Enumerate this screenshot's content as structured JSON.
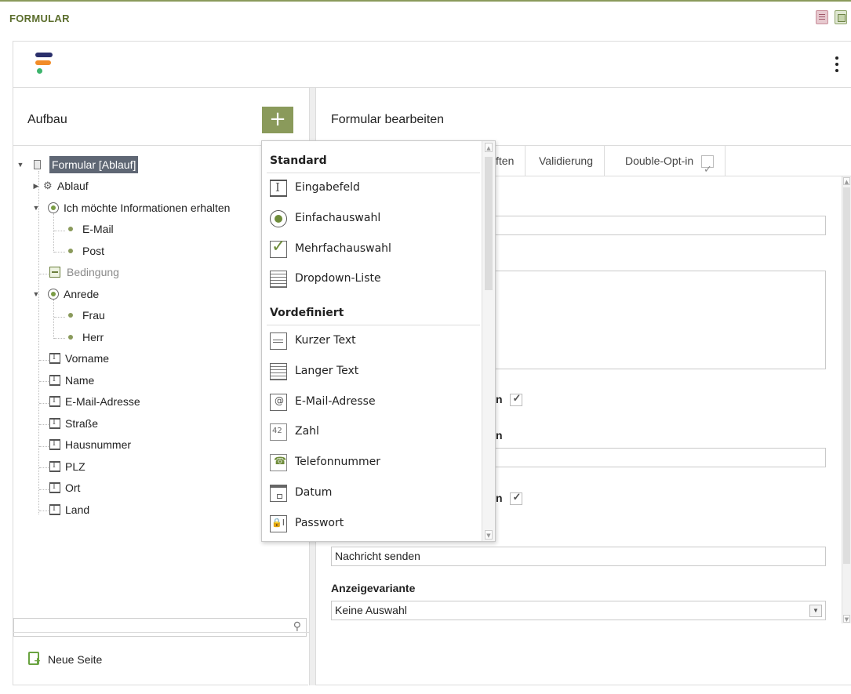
{
  "window": {
    "title": "FORMULAR"
  },
  "left_panel": {
    "title": "Aufbau",
    "add_label": "+",
    "tree": [
      {
        "label": "Formular [Ablauf]",
        "icon": "form-icon",
        "selected": true
      },
      {
        "label": "Ablauf",
        "icon": "gear-icon"
      },
      {
        "label": "Ich möchte Informationen erhalten",
        "icon": "radio-icon"
      },
      {
        "label": "E-Mail",
        "icon": "option-dot-icon"
      },
      {
        "label": "Post",
        "icon": "option-dot-icon"
      },
      {
        "label": "Bedingung",
        "icon": "condition-icon"
      },
      {
        "label": "Anrede",
        "icon": "radio-icon"
      },
      {
        "label": "Frau",
        "icon": "option-dot-icon"
      },
      {
        "label": "Herr",
        "icon": "option-dot-icon"
      },
      {
        "label": "Vorname",
        "icon": "text-field-icon"
      },
      {
        "label": "Name",
        "icon": "text-field-icon"
      },
      {
        "label": "E-Mail-Adresse",
        "icon": "text-field-icon"
      },
      {
        "label": "Straße",
        "icon": "text-field-icon"
      },
      {
        "label": "Hausnummer",
        "icon": "text-field-icon"
      },
      {
        "label": "PLZ",
        "icon": "text-field-icon"
      },
      {
        "label": "Ort",
        "icon": "text-field-icon"
      },
      {
        "label": "Land",
        "icon": "text-field-icon"
      }
    ],
    "search_value": "",
    "new_page_label": "Neue Seite"
  },
  "right_panel": {
    "title": "Formular bearbeiten",
    "tabs": [
      {
        "label": "ften"
      },
      {
        "label": "Validierung"
      },
      {
        "label": "Double-Opt-in"
      }
    ],
    "partial_label_1": "n",
    "partial_label_2": "n",
    "partial_label_3": "n",
    "button_text_value": "Nachricht senden",
    "variant_label": "Anzeigevariante",
    "variant_value": "Keine Auswahl"
  },
  "menu": {
    "sections": [
      {
        "title": "Standard",
        "items": [
          {
            "label": "Eingabefeld",
            "icon": "input-field-icon"
          },
          {
            "label": "Einfachauswahl",
            "icon": "single-choice-icon"
          },
          {
            "label": "Mehrfachauswahl",
            "icon": "multiple-choice-icon"
          },
          {
            "label": "Dropdown-Liste",
            "icon": "dropdown-list-icon"
          }
        ]
      },
      {
        "title": "Vordefiniert",
        "items": [
          {
            "label": "Kurzer Text",
            "icon": "short-text-icon"
          },
          {
            "label": "Langer Text",
            "icon": "long-text-icon"
          },
          {
            "label": "E-Mail-Adresse",
            "icon": "email-icon"
          },
          {
            "label": "Zahl",
            "icon": "number-icon"
          },
          {
            "label": "Telefonnummer",
            "icon": "phone-icon"
          },
          {
            "label": "Datum",
            "icon": "calendar-icon"
          },
          {
            "label": "Passwort",
            "icon": "password-icon"
          }
        ]
      }
    ]
  },
  "colors": {
    "accent": "#8a9a5b",
    "title": "#5c6e2d",
    "selection": "#5f6774"
  }
}
